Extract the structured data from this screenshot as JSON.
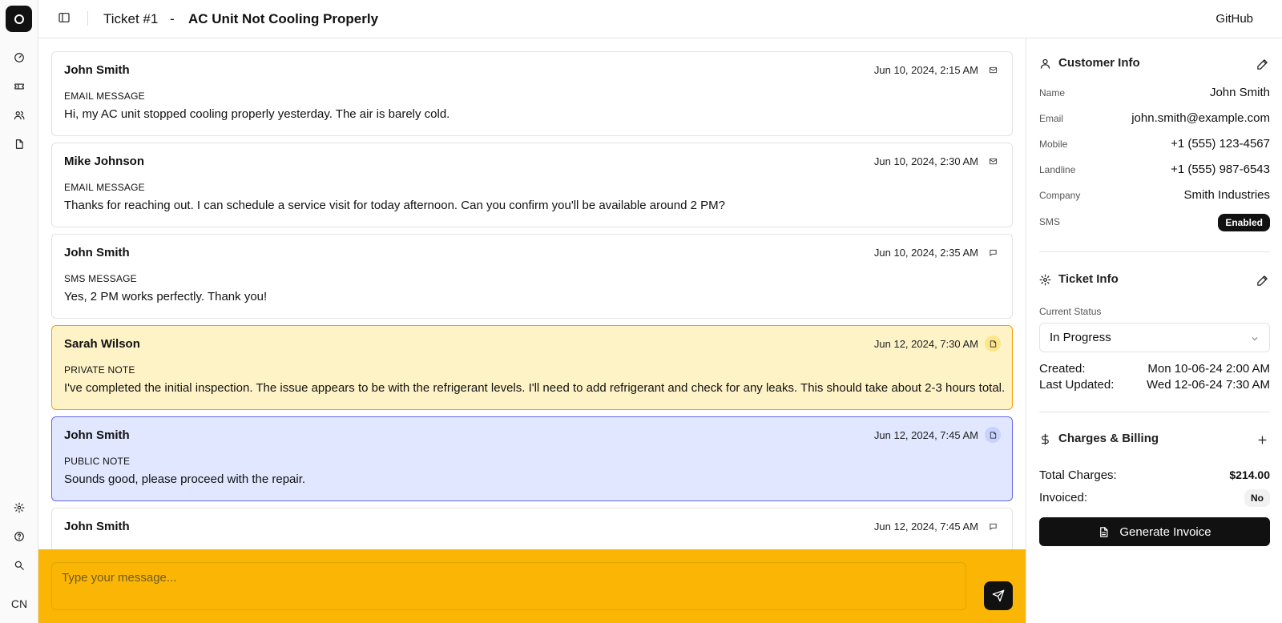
{
  "rail": {
    "avatar_initials": "CN",
    "icons": [
      "dashboard-icon",
      "ticket-icon",
      "users-icon",
      "document-icon",
      "settings-icon",
      "help-icon",
      "search-icon"
    ]
  },
  "header": {
    "ticket_label": "Ticket #1",
    "separator": "-",
    "title": "AC Unit Not Cooling Properly",
    "github_label": "GitHub"
  },
  "messages": [
    {
      "author": "John Smith",
      "time": "Jun 10, 2024, 2:15 AM",
      "type": "EMAIL MESSAGE",
      "body": "Hi, my AC unit stopped cooling properly yesterday. The air is barely cold.",
      "icon": "mail-icon"
    },
    {
      "author": "Mike Johnson",
      "time": "Jun 10, 2024, 2:30 AM",
      "type": "EMAIL MESSAGE",
      "body": "Thanks for reaching out. I can schedule a service visit for today afternoon. Can you confirm you'll be available around 2 PM?",
      "icon": "mail-icon"
    },
    {
      "author": "John Smith",
      "time": "Jun 10, 2024, 2:35 AM",
      "type": "SMS MESSAGE",
      "body": "Yes, 2 PM works perfectly. Thank you!",
      "icon": "chat-icon"
    },
    {
      "author": "Sarah Wilson",
      "time": "Jun 12, 2024, 7:30 AM",
      "type": "PRIVATE NOTE",
      "body": "I've completed the initial inspection. The issue appears to be with the refrigerant levels. I'll need to add refrigerant and check for any leaks. This should take about 2-3 hours total.",
      "icon": "note-icon"
    },
    {
      "author": "John Smith",
      "time": "Jun 12, 2024, 7:45 AM",
      "type": "PUBLIC NOTE",
      "body": "Sounds good, please proceed with the repair.",
      "icon": "note-icon"
    },
    {
      "author": "John Smith",
      "time": "Jun 12, 2024, 7:45 AM",
      "type": "",
      "body": "",
      "icon": "chat-icon"
    }
  ],
  "composer": {
    "placeholder": "Type your message...",
    "value": ""
  },
  "customer_info": {
    "title": "Customer Info",
    "fields": [
      {
        "label": "Name",
        "value": "John Smith"
      },
      {
        "label": "Email",
        "value": "john.smith@example.com"
      },
      {
        "label": "Mobile",
        "value": "+1 (555) 123-4567"
      },
      {
        "label": "Landline",
        "value": "+1 (555) 987-6543"
      },
      {
        "label": "Company",
        "value": "Smith Industries"
      }
    ],
    "sms_label": "SMS",
    "sms_status": "Enabled"
  },
  "ticket_info": {
    "title": "Ticket Info",
    "status_label": "Current Status",
    "status_value": "In Progress",
    "created_label": "Created:",
    "created_value": "Mon 10-06-24 2:00 AM",
    "updated_label": "Last Updated:",
    "updated_value": "Wed 12-06-24 7:30 AM"
  },
  "billing": {
    "title": "Charges & Billing",
    "total_label": "Total Charges:",
    "total_value": "$214.00",
    "invoiced_label": "Invoiced:",
    "invoiced_value": "No",
    "invoice_button": "Generate Invoice"
  },
  "colors": {
    "private_note_bg": "#fef3c7",
    "private_note_border": "#f59e0b",
    "public_note_bg": "#e0e7ff",
    "public_note_border": "#6366f1",
    "composer_bg": "#fbb605",
    "primary_dark": "#111111"
  }
}
